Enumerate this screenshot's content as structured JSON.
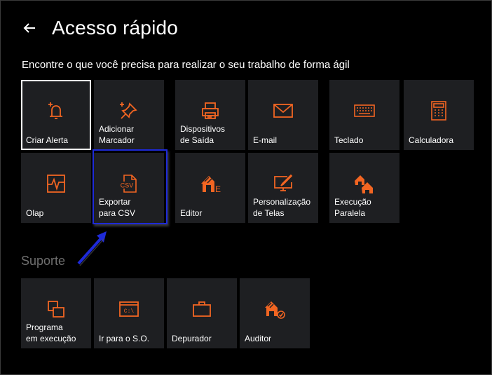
{
  "header": {
    "title": "Acesso rápido",
    "subtitle": "Encontre o que você precisa para realizar o seu trabalho de forma ágil"
  },
  "colors": {
    "accent": "#f26522",
    "tile_bg": "#1e1f22",
    "highlight": "#1e2ad8"
  },
  "tiles": {
    "criar_alerta": {
      "label": "Criar Alerta",
      "icon": "bell-plus-icon"
    },
    "adicionar_marcador": {
      "label": "Adicionar\nMarcador",
      "icon": "pin-plus-icon"
    },
    "dispositivos_saida": {
      "label": "Dispositivos\nde Saída",
      "icon": "printer-icon"
    },
    "email": {
      "label": "E-mail",
      "icon": "envelope-icon"
    },
    "teclado": {
      "label": "Teclado",
      "icon": "keyboard-icon"
    },
    "calculadora": {
      "label": "Calculadora",
      "icon": "calculator-icon"
    },
    "olap": {
      "label": "Olap",
      "icon": "chart-icon"
    },
    "exportar_csv": {
      "label": "Exportar\npara CSV",
      "icon": "csv-file-icon",
      "icon_text": "CSV"
    },
    "editor": {
      "label": "Editor",
      "icon": "editor-icon",
      "icon_text": "E"
    },
    "personalizacao": {
      "label": "Personalização\nde Telas",
      "icon": "screen-pen-icon"
    },
    "execucao_paralela": {
      "label": "Execução\nParalela",
      "icon": "parallel-icon"
    }
  },
  "suporte": {
    "title": "Suporte",
    "tiles": {
      "programa": {
        "label": "Programa\nem execução",
        "icon": "windows-icon"
      },
      "ir_so": {
        "label": "Ir para o S.O.",
        "icon": "terminal-icon",
        "icon_text": "C:\\"
      },
      "depurador": {
        "label": "Depurador",
        "icon": "briefcase-icon"
      },
      "auditor": {
        "label": "Auditor",
        "icon": "auditor-icon"
      }
    }
  }
}
